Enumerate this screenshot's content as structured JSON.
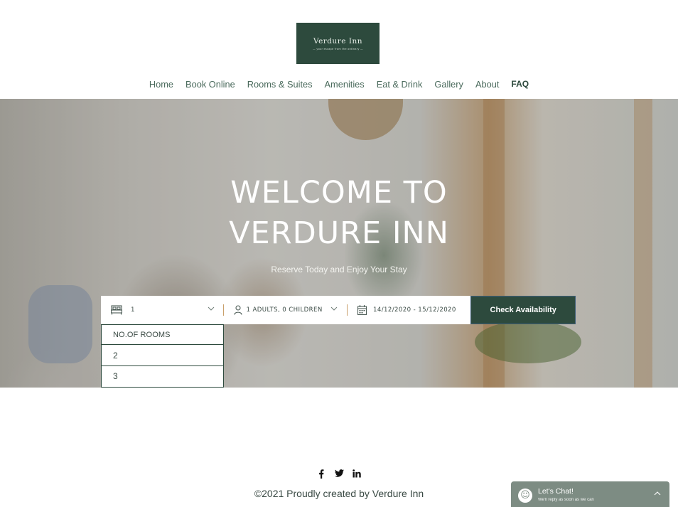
{
  "logo": {
    "name": "Verdure Inn",
    "tagline": "your escape from the ordinary"
  },
  "nav": {
    "items": [
      "Home",
      "Book Online",
      "Rooms & Suites",
      "Amenities",
      "Eat & Drink",
      "Gallery",
      "About",
      "FAQ"
    ]
  },
  "hero": {
    "title": "WELCOME TO\nVERDURE INN",
    "subtitle": "Reserve Today and Enjoy Your Stay"
  },
  "booking": {
    "rooms_value": "1",
    "guests_value": "1 ADULTS, 0 CHILDREN",
    "dates_value": "14/12/2020 - 15/12/2020",
    "check_label": "Check Availability",
    "colors": {
      "button": "#2d4a3d",
      "separator": "#c9a06b"
    }
  },
  "rooms_dropdown": {
    "header": "NO.OF ROOMS",
    "options": [
      "2",
      "3"
    ]
  },
  "footer": {
    "social": {
      "facebook": "f",
      "twitter": "t",
      "linkedin": "in"
    },
    "copyright": "©2021 Proudly created by Verdure Inn"
  },
  "chat": {
    "title": "Let's Chat!",
    "subtitle": "We'll reply as soon as we can",
    "icons": {
      "avatar": "chat-bubble-icon",
      "toggle": "chevron-up-icon"
    }
  }
}
